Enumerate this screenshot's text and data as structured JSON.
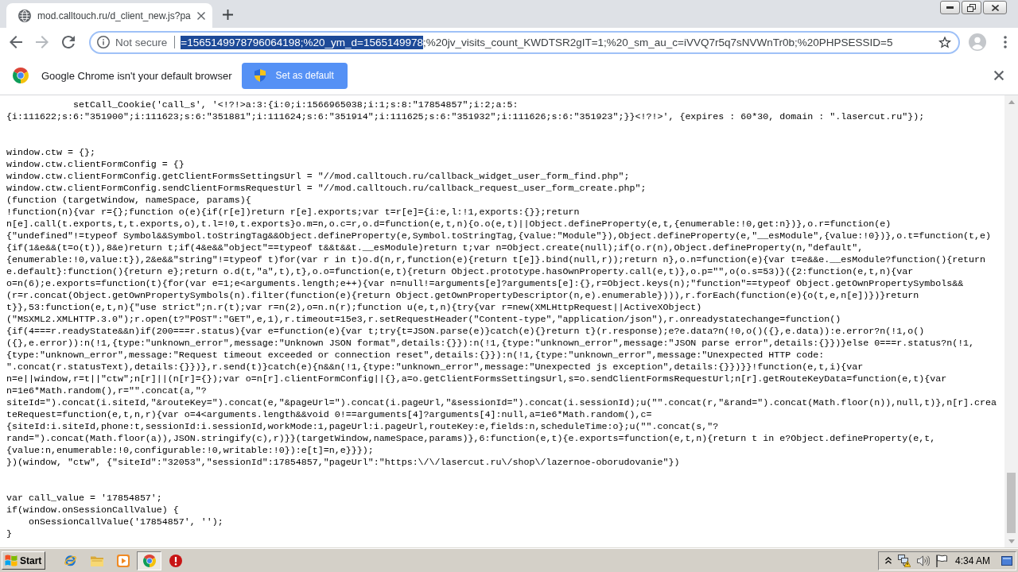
{
  "browser": {
    "tabs": [
      {
        "title": "mod.calltouch.ru/d_client_new.js?pa",
        "selected": true
      }
    ],
    "address_bar": {
      "security_label": "Not secure",
      "selected_text": "=1565149978796064198;%20_ym_d=1565149978",
      "text": ";%20jv_visits_count_KWDTSR2gIT=1;%20_sm_au_c=iVVQ7r5q7sNVWnTr0b;%20PHPSESSID=5"
    }
  },
  "infobar": {
    "message": "Google Chrome isn't your default browser",
    "button": "Set as default"
  },
  "code_blocks": [
    {
      "lines": [
        "            setCall_Cookie('call_s', '<!?!>a:3:{i:0;i:1566965038;i:1;s:8:\"17854857\";i:2;a:5:",
        "{i:111622;s:6:\"351900\";i:111623;s:6:\"351881\";i:111624;s:6:\"351914\";i:111625;s:6:\"351932\";i:111626;s:6:\"351923\";}}<!?!>', {expires : 60*30, domain : \".lasercut.ru\"});"
      ]
    },
    {
      "lines": [
        "window.ctw = {};",
        "window.ctw.clientFormConfig = {}",
        "window.ctw.clientFormConfig.getClientFormsSettingsUrl = \"//mod.calltouch.ru/callback_widget_user_form_find.php\";",
        "window.ctw.clientFormConfig.sendClientFormsRequestUrl = \"//mod.calltouch.ru/callback_request_user_form_create.php\";",
        "(function (targetWindow, nameSpace, params){",
        "!function(n){var r={};function o(e){if(r[e])return r[e].exports;var t=r[e]={i:e,l:!1,exports:{}};return",
        "n[e].call(t.exports,t,t.exports,o),t.l=!0,t.exports}o.m=n,o.c=r,o.d=function(e,t,n){o.o(e,t)||Object.defineProperty(e,t,{enumerable:!0,get:n})},o.r=function(e)",
        "{\"undefined\"!=typeof Symbol&&Symbol.toStringTag&&Object.defineProperty(e,Symbol.toStringTag,{value:\"Module\"}),Object.defineProperty(e,\"__esModule\",{value:!0})},o.t=function(t,e)",
        "{if(1&e&&(t=o(t)),8&e)return t;if(4&e&&\"object\"==typeof t&&t&&t.__esModule)return t;var n=Object.create(null);if(o.r(n),Object.defineProperty(n,\"default\",",
        "{enumerable:!0,value:t}),2&e&&\"string\"!=typeof t)for(var r in t)o.d(n,r,function(e){return t[e]}.bind(null,r));return n},o.n=function(e){var t=e&&e.__esModule?function(){return",
        "e.default}:function(){return e};return o.d(t,\"a\",t),t},o.o=function(e,t){return Object.prototype.hasOwnProperty.call(e,t)},o.p=\"\",o(o.s=53)}({2:function(e,t,n){var",
        "o=n(6);e.exports=function(t){for(var e=1;e<arguments.length;e++){var n=null!=arguments[e]?arguments[e]:{},r=Object.keys(n);\"function\"==typeof Object.getOwnPropertySymbols&&",
        "(r=r.concat(Object.getOwnPropertySymbols(n).filter(function(e){return Object.getOwnPropertyDescriptor(n,e).enumerable}))),r.forEach(function(e){o(t,e,n[e])})}return",
        "t}},53:function(e,t,n){\"use strict\";n.r(t);var r=n(2),o=n.n(r);function u(e,t,n){try{var r=new(XMLHttpRequest||ActiveXObject)",
        "(\"MSXML2.XMLHTTP.3.0\");r.open(t?\"POST\":\"GET\",e,1),r.timeout=15e3,r.setRequestHeader(\"Content-type\",\"application/json\"),r.onreadystatechange=function()",
        "{if(4===r.readyState&&n)if(200===r.status){var e=function(e){var t;try{t=JSON.parse(e)}catch(e){}return t}(r.response);e?e.data?n(!0,o()({},e.data)):e.error?n(!1,o()",
        "({},e.error)):n(!1,{type:\"unknown_error\",message:\"Unknown JSON format\",details:{}}):n(!1,{type:\"unknown_error\",message:\"JSON parse error\",details:{}})}else 0===r.status?n(!1,",
        "{type:\"unknown_error\",message:\"Request timeout exceeded or connection reset\",details:{}}):n(!1,{type:\"unknown_error\",message:\"Unexpected HTTP code:",
        "\".concat(r.statusText),details:{}})},r.send(t)}catch(e){n&&n(!1,{type:\"unknown_error\",message:\"Unexpected js exception\",details:{}})}}!function(e,t,i){var",
        "n=e||window,r=t||\"ctw\";n[r]||(n[r]={});var o=n[r].clientFormConfig||{},a=o.getClientFormsSettingsUrl,s=o.sendClientFormsRequestUrl;n[r].getRouteKeyData=function(e,t){var",
        "n=1e6*Math.random(),r=\"\".concat(a,\"?",
        "siteId=\").concat(i.siteId,\"&routeKey=\").concat(e,\"&pageUrl=\").concat(i.pageUrl,\"&sessionId=\").concat(i.sessionId);u(\"\".concat(r,\"&rand=\").concat(Math.floor(n)),null,t)},n[r].crea",
        "teRequest=function(e,t,n,r){var o=4<arguments.length&&void 0!==arguments[4]?arguments[4]:null,a=1e6*Math.random(),c=",
        "{siteId:i.siteId,phone:t,sessionId:i.sessionId,workMode:1,pageUrl:i.pageUrl,routeKey:e,fields:n,scheduleTime:o};u(\"\".concat(s,\"?",
        "rand=\").concat(Math.floor(a)),JSON.stringify(c),r)}}(targetWindow,nameSpace,params)},6:function(e,t){e.exports=function(e,t,n){return t in e?Object.defineProperty(e,t,",
        "{value:n,enumerable:!0,configurable:!0,writable:!0}):e[t]=n,e}}});",
        "})(window, \"ctw\", {\"siteId\":\"32053\",\"sessionId\":17854857,\"pageUrl\":\"https:\\/\\/lasercut.ru\\/shop\\/lazernoe-oborudovanie\"})"
      ]
    },
    {
      "lines": [
        "var call_value = '17854857';",
        "if(window.onSessionCallValue) {",
        "    onSessionCallValue('17854857', '');",
        "}"
      ]
    }
  ],
  "taskbar": {
    "start": "Start",
    "apps": [
      {
        "kind": "ie",
        "selected": false
      },
      {
        "kind": "folder",
        "selected": false
      },
      {
        "kind": "media",
        "selected": false
      },
      {
        "kind": "chrome",
        "selected": true
      },
      {
        "kind": "alert",
        "selected": false
      }
    ],
    "clock": "4:34 AM"
  }
}
